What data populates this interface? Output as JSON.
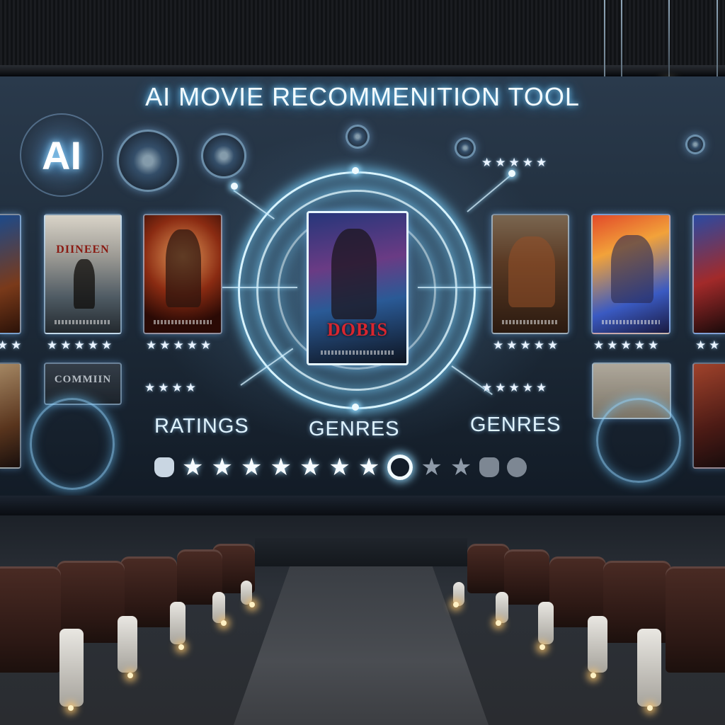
{
  "header": {
    "title": "AI MOVIE RECOMMENITION TOOL"
  },
  "badge": {
    "text": "AI"
  },
  "featured": {
    "title": "DOBIS"
  },
  "posters": [
    {
      "title": ""
    },
    {
      "title": "DIINEEN"
    },
    {
      "title": ""
    },
    {
      "title": ""
    },
    {
      "title": ""
    },
    {
      "title": ""
    },
    {
      "title": "COMMIIN"
    }
  ],
  "labels": {
    "left": "RATINGS",
    "center": "GENRES",
    "right": "GENRES"
  },
  "icons": [
    "ai-badge-icon",
    "orb-icon",
    "star-icon",
    "ring-icon",
    "pendant-light-icon",
    "aisle-light-icon"
  ],
  "colors": {
    "glow": "#7fd6ff",
    "accent_red": "#d8262f",
    "seat": "#3a211b"
  }
}
